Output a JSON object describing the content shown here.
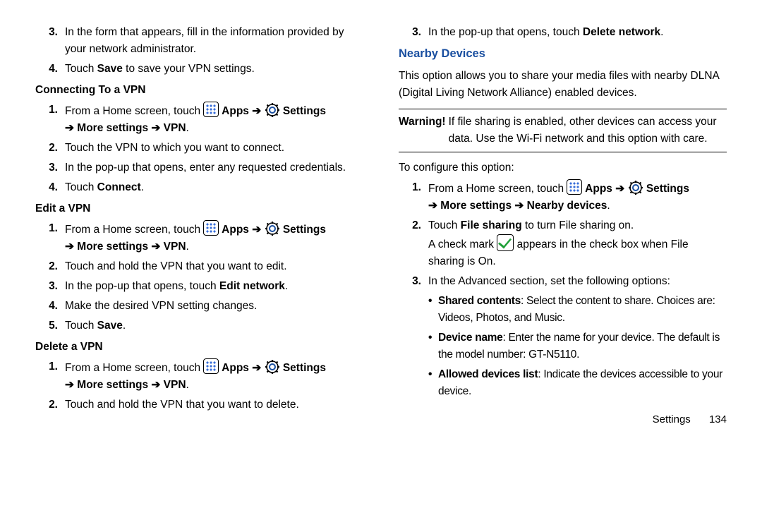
{
  "left": {
    "cont3": "In the form that appears, fill in the information provided by your network administrator.",
    "cont4a": "Touch ",
    "cont4b": "Save",
    "cont4c": " to save your VPN settings.",
    "h_connect": "Connecting To a VPN",
    "c1a": "From a Home screen, touch ",
    "c1b": " Apps ",
    "c1c": "➔",
    "c1d": " Settings ",
    "c1e": "➔ More settings ➔ VPN",
    "c1f": ".",
    "c2": "Touch the VPN to which you want to connect.",
    "c3": "In the pop-up that opens, enter any requested credentials.",
    "c4a": "Touch ",
    "c4b": "Connect",
    "c4c": ".",
    "h_edit": "Edit a VPN",
    "e2": "Touch and hold the VPN that you want to edit.",
    "e3a": "In the pop-up that opens, touch ",
    "e3b": "Edit network",
    "e3c": ".",
    "e4": "Make the desired VPN setting changes.",
    "e5a": "Touch ",
    "e5b": "Save",
    "e5c": ".",
    "h_delete": "Delete a VPN",
    "d2": "Touch and hold the VPN that you want to delete."
  },
  "right": {
    "r3a": "In the pop-up that opens, touch ",
    "r3b": "Delete network",
    "r3c": ".",
    "h_nearby": "Nearby Devices",
    "nd_intro": "This option allows you to share your media files with nearby DLNA (Digital Living Network Alliance) enabled devices.",
    "warn_label": "Warning!",
    "warn_text": " If file sharing is enabled, other devices can access your data. Use the Wi-Fi network and this option with care.",
    "cfg_intro": "To configure this option:",
    "n1e": "➔ More settings ➔ Nearby devices",
    "n2a": "Touch ",
    "n2b": "File sharing",
    "n2c": " to turn File sharing on.",
    "n2d": "A check mark ",
    "n2e": " appears in the check box when File sharing is On.",
    "n3": "In the Advanced section, set the following options:",
    "b1a": "Shared contents",
    "b1b": ": Select the content to share. Choices are: Videos, Photos, and Music.",
    "b2a": "Device name",
    "b2b": ": Enter the name for your device. The default is the model number: GT-N5110.",
    "b3a": "Allowed devices list",
    "b3b": ": Indicate the devices accessible to your device."
  },
  "footer": {
    "label": "Settings",
    "page": "134"
  }
}
